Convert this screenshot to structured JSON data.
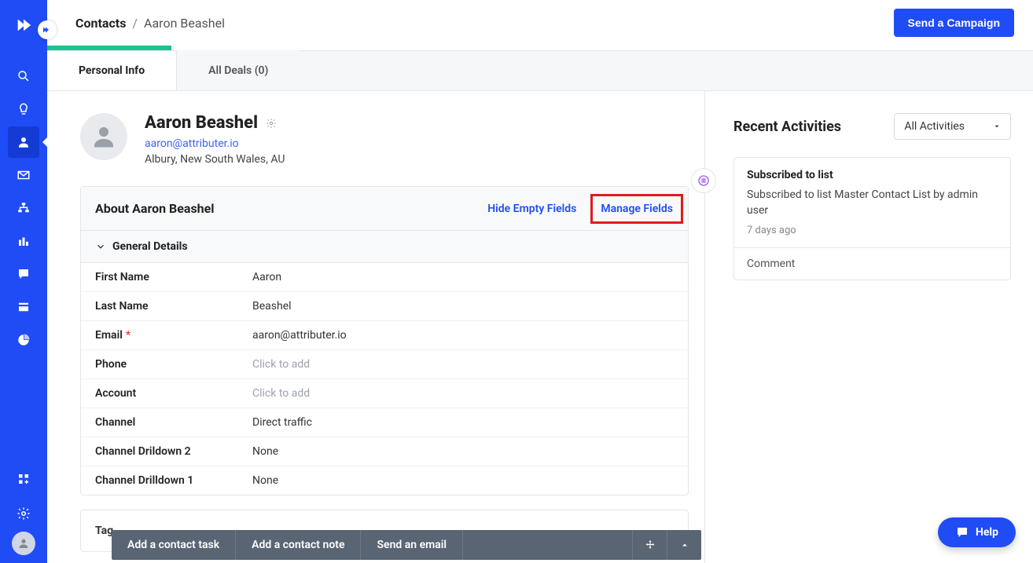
{
  "breadcrumb": {
    "root": "Contacts",
    "sep": "/",
    "leaf": "Aaron Beashel"
  },
  "header": {
    "send_campaign": "Send a Campaign"
  },
  "tabs": [
    {
      "label": "Personal Info",
      "active": true
    },
    {
      "label": "All Deals (0)",
      "active": false
    }
  ],
  "contact": {
    "name": "Aaron Beashel",
    "email": "aaron@attributer.io",
    "location": "Albury, New South Wales, AU"
  },
  "about": {
    "title": "About Aaron Beashel",
    "hide_empty": "Hide Empty Fields",
    "manage_fields": "Manage Fields",
    "section": "General Details",
    "fields": [
      {
        "label": "First Name",
        "value": "Aaron",
        "placeholder": false
      },
      {
        "label": "Last Name",
        "value": "Beashel",
        "placeholder": false
      },
      {
        "label": "Email",
        "value": "aaron@attributer.io",
        "required": true,
        "placeholder": false
      },
      {
        "label": "Phone",
        "value": "Click to add",
        "placeholder": true
      },
      {
        "label": "Account",
        "value": "Click to add",
        "placeholder": true
      },
      {
        "label": "Channel",
        "value": "Direct traffic",
        "placeholder": false
      },
      {
        "label": "Channel Drildown 2",
        "value": "None",
        "placeholder": false
      },
      {
        "label": "Channel Drilldown 1",
        "value": "None",
        "placeholder": false
      }
    ]
  },
  "tags": {
    "title": "Tag"
  },
  "activities": {
    "title": "Recent Activities",
    "filter": "All Activities",
    "items": [
      {
        "title": "Subscribed to list",
        "desc": "Subscribed to list Master Contact List by admin user",
        "time": "7 days ago",
        "comment": "Comment"
      }
    ]
  },
  "action_bar": {
    "task": "Add a contact task",
    "note": "Add a contact note",
    "email": "Send an email"
  },
  "help": {
    "label": "Help"
  },
  "sidebar_icons": [
    "search-icon",
    "lightbulb-icon",
    "person-icon",
    "envelope-icon",
    "sitemap-icon",
    "campaigns-icon",
    "chat-icon",
    "form-icon",
    "piechart-icon"
  ],
  "sidebar_bottom": [
    "apps-icon",
    "gear-icon",
    "avatar"
  ]
}
